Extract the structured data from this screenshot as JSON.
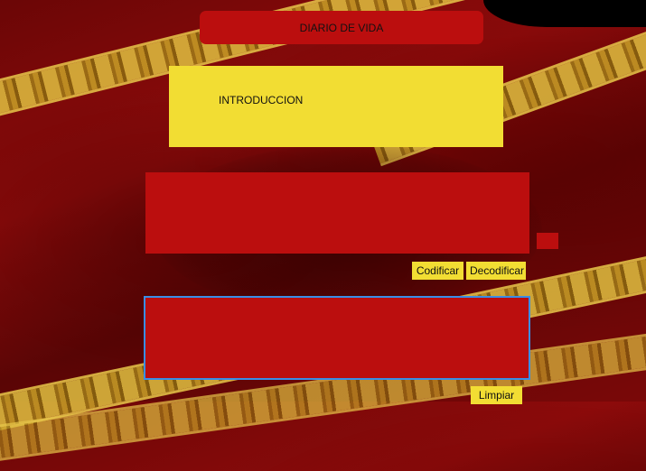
{
  "header": {
    "title": "DIARIO DE VIDA"
  },
  "intro": {
    "label": "INTRODUCCION"
  },
  "editor": {
    "input_value": "",
    "output_value": ""
  },
  "actions": {
    "encode_label": "Codificar",
    "decode_label": "Decodificar",
    "clear_label": "Limpiar"
  },
  "colors": {
    "panel_red": "#bb0e0e",
    "button_yellow": "#f2dd33",
    "focus_blue": "#3a8ee6"
  }
}
